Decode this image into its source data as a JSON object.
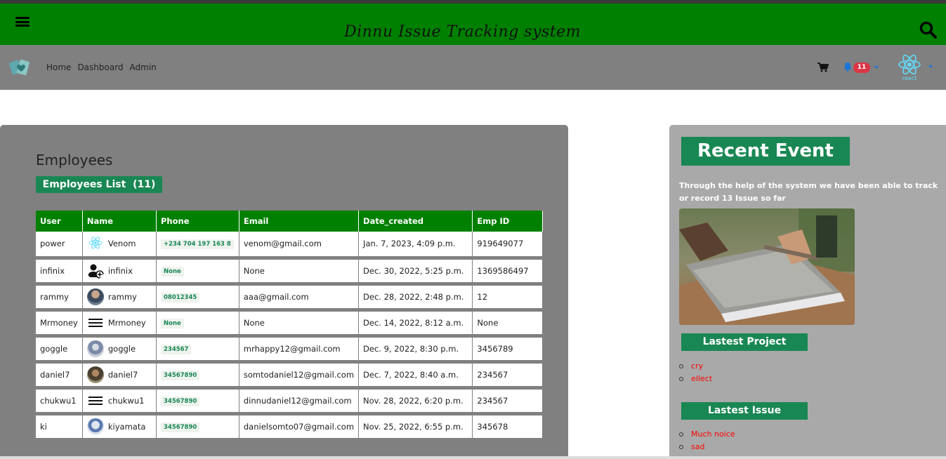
{
  "header": {
    "site_title": "Dinnu Issue Tracking system"
  },
  "navbar": {
    "links": [
      "Home",
      "Dashboard",
      "Admin"
    ],
    "notification_count": "11",
    "avatar_text": "react"
  },
  "employees": {
    "heading": "Employees",
    "list_label": "Employees List",
    "list_count": "(11)",
    "columns": [
      "User",
      "Name",
      "Phone",
      "Email",
      "Date_created",
      "Emp ID"
    ],
    "rows": [
      {
        "user": "power",
        "name": "Venom",
        "phone": "+234 704 197 163 8",
        "email": "venom@gmail.com",
        "date": "Jan. 7, 2023, 4:09 p.m.",
        "emp_id": "919649077",
        "avatar": "react-icon"
      },
      {
        "user": "infinix",
        "name": "infinix",
        "phone": "None",
        "email": "None",
        "date": "Dec. 30, 2022, 5:25 p.m.",
        "emp_id": "1369586497",
        "avatar": "add-user-icon"
      },
      {
        "user": "rammy",
        "name": "rammy",
        "phone": "08012345",
        "email": "aaa@gmail.com",
        "date": "Dec. 28, 2022, 2:48 p.m.",
        "emp_id": "12",
        "avatar": "photo"
      },
      {
        "user": "Mrmoney",
        "name": "Mrmoney",
        "phone": "None",
        "email": "None",
        "date": "Dec. 14, 2022, 8:12 a.m.",
        "emp_id": "None",
        "avatar": "menu-icon"
      },
      {
        "user": "goggle",
        "name": "goggle",
        "phone": "234567",
        "email": "mrhappy12@gmail.com",
        "date": "Dec. 9, 2022, 8:30 p.m.",
        "emp_id": "3456789",
        "avatar": "photo"
      },
      {
        "user": "daniel7",
        "name": "daniel7",
        "phone": "34567890",
        "email": "somtodaniel12@gmail.com",
        "date": "Dec. 7, 2022, 8:40 a.m.",
        "emp_id": "234567",
        "avatar": "photo"
      },
      {
        "user": "chukwu1",
        "name": "chukwu1",
        "phone": "34567890",
        "email": "dinnudaniel12@gmail.com",
        "date": "Nov. 28, 2022, 6:20 p.m.",
        "emp_id": "234567",
        "avatar": "menu-icon"
      },
      {
        "user": "ki",
        "name": "kiyamata",
        "phone": "34567890",
        "email": "danielsomto07@gmail.com",
        "date": "Nov. 25, 2022, 6:55 p.m.",
        "emp_id": "345678",
        "avatar": "photo"
      }
    ]
  },
  "recent": {
    "title": "Recent Event",
    "description": "Through the help of the system we have been able to track or record 13 Issue so far",
    "latest_project_label": "Lastest Project",
    "projects": [
      "cry",
      "ellect"
    ],
    "latest_issue_label": "Lastest Issue",
    "issues": [
      "Much noice",
      "sad"
    ]
  },
  "colors": {
    "header_green": "#008000",
    "badge_green": "#198754",
    "nav_gray": "#808080",
    "panel_gray": "#a9a9a9",
    "notification_red": "#dc3545",
    "link_red": "#ff0000"
  }
}
